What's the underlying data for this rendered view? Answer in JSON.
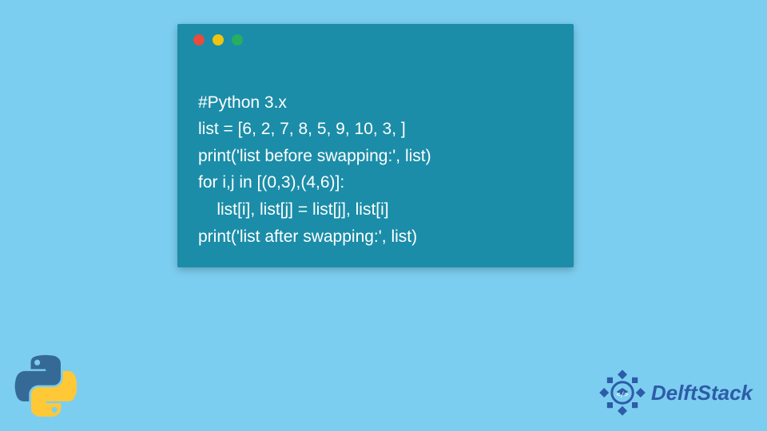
{
  "code": {
    "lines": [
      "#Python 3.x",
      "list = [6, 2, 7, 8, 5, 9, 10, 3, ]",
      "print('list before swapping:', list)",
      "for i,j in [(0,3),(4,6)]:",
      "    list[i], list[j] = list[j], list[i]",
      "print('list after swapping:', list)"
    ]
  },
  "brand": {
    "name": "DelftStack"
  },
  "window": {
    "dot_red": "#e74c3c",
    "dot_yellow": "#f1c40f",
    "dot_green": "#27ae60"
  }
}
